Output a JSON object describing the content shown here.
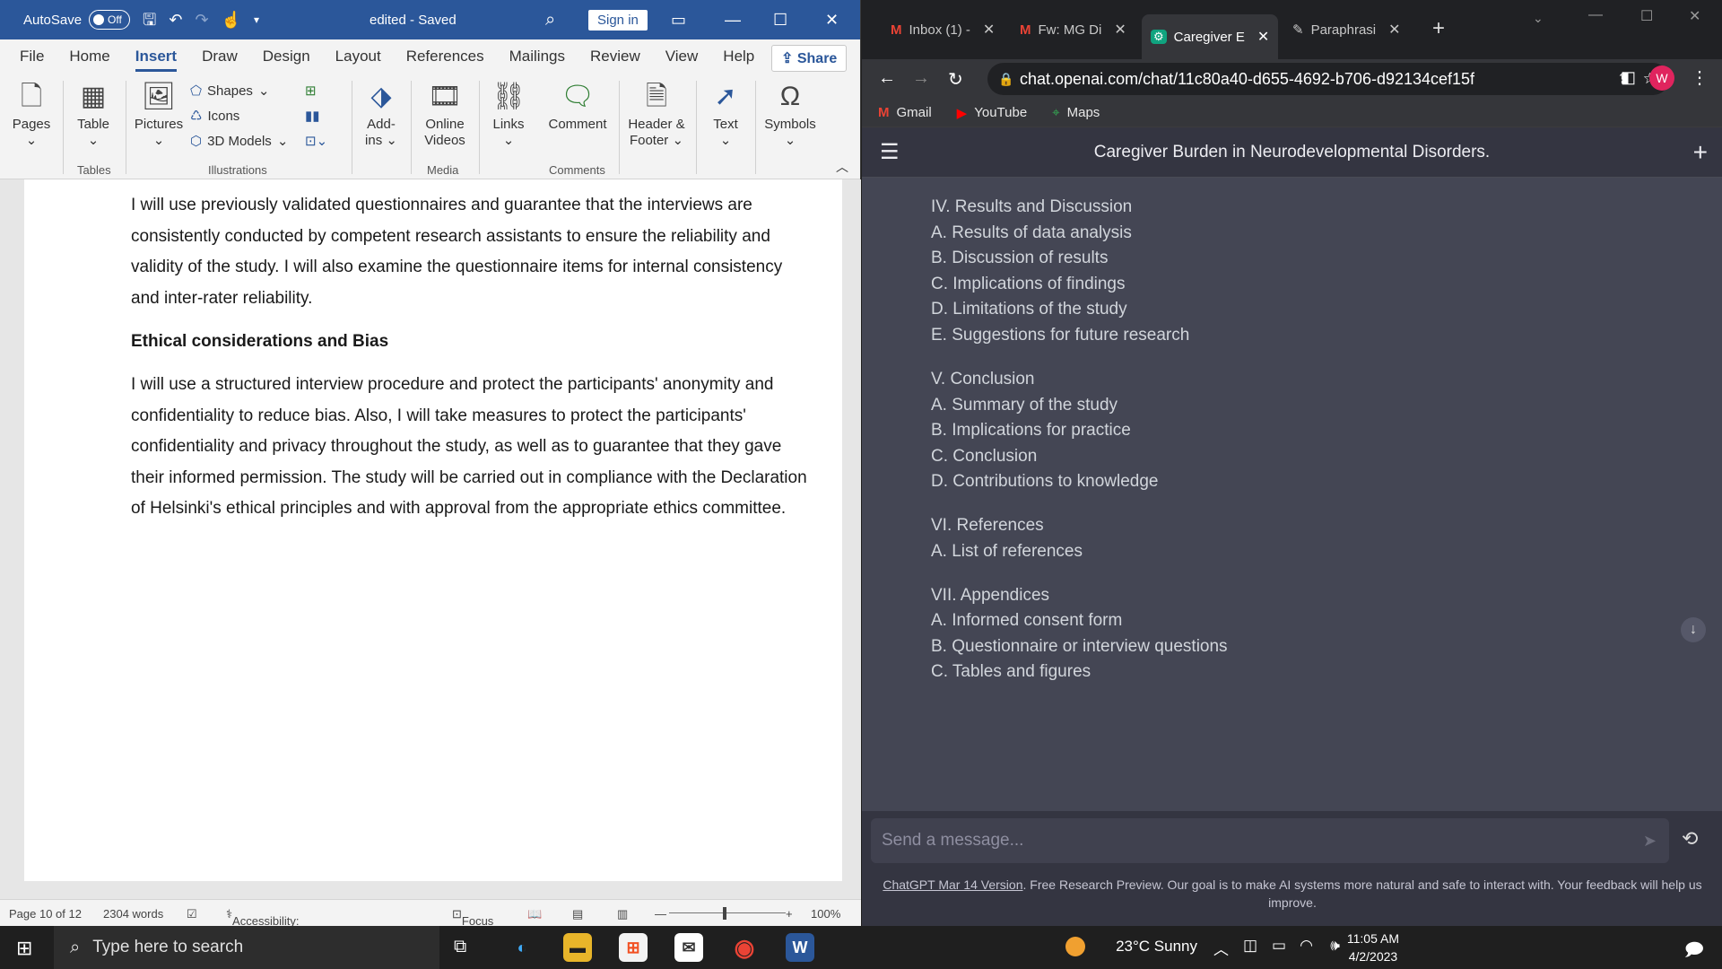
{
  "word": {
    "autosave_label": "AutoSave",
    "autosave_state": "Off",
    "doc_title": "edited  -  Saved",
    "sign_in": "Sign in",
    "tabs": [
      "File",
      "Home",
      "Insert",
      "Draw",
      "Design",
      "Layout",
      "References",
      "Mailings",
      "Review",
      "View",
      "Help"
    ],
    "share": "Share",
    "ribbon": {
      "pages": "Pages",
      "table": "Table",
      "pictures": "Pictures",
      "shapes": "Shapes",
      "icons": "Icons",
      "models": "3D Models",
      "addins_1": "Add-",
      "addins_2": "ins",
      "online_1": "Online",
      "online_2": "Videos",
      "links": "Links",
      "comment": "Comment",
      "header_1": "Header &",
      "header_2": "Footer",
      "text": "Text",
      "symbols": "Symbols",
      "groups": {
        "tables": "Tables",
        "illustrations": "Illustrations",
        "media": "Media",
        "comments": "Comments"
      }
    },
    "document": {
      "para1": "I will use previously validated questionnaires and guarantee that the interviews are consistently conducted by competent research assistants to ensure the reliability and validity of the study. I will also examine the questionnaire items for internal consistency and inter-rater reliability.",
      "heading": "Ethical considerations and Bias",
      "para2": "I will use a structured interview procedure and protect the participants' anonymity and confidentiality to reduce bias. Also, I will take measures to protect the participants' confidentiality and privacy throughout the study, as well as to guarantee that they gave their informed permission. The study will be carried out in compliance with the Declaration of Helsinki's ethical principles and with approval from the appropriate ethics committee."
    },
    "status": {
      "page": "Page 10 of 12",
      "words": "2304 words",
      "accessibility": "Accessibility: Good to go",
      "focus": "Focus",
      "zoom": "100%"
    }
  },
  "browser": {
    "tabs": [
      {
        "label": "Inbox (1) -",
        "icon": "gmail-icon"
      },
      {
        "label": "Fw: MG Di",
        "icon": "gmail-icon"
      },
      {
        "label": "Caregiver E",
        "icon": "chatgpt-icon"
      },
      {
        "label": "Paraphrasi",
        "icon": "quill-icon"
      }
    ],
    "url": "chat.openai.com/chat/11c80a40-d655-4692-b706-d92134cef15f",
    "avatar": "W",
    "bookmarks": [
      "Gmail",
      "YouTube",
      "Maps"
    ],
    "chat_title": "Caregiver Burden in Neurodevelopmental Disorders.",
    "outline": [
      "IV. Results and Discussion",
      "A. Results of data analysis",
      "B. Discussion of results",
      "C. Implications of findings",
      "D. Limitations of the study",
      "E. Suggestions for future research",
      "V. Conclusion",
      "A. Summary of the study",
      "B. Implications for practice",
      "C. Conclusion",
      "D. Contributions to knowledge",
      "VI. References",
      "A. List of references",
      "VII. Appendices",
      "A. Informed consent form",
      "B. Questionnaire or interview questions",
      "C. Tables and figures"
    ],
    "message_placeholder": "Send a message...",
    "footer_link": "ChatGPT Mar 14 Version",
    "footer_text": ". Free Research Preview. Our goal is to make AI systems more natural and safe to interact with. Your feedback will help us improve."
  },
  "taskbar": {
    "search_placeholder": "Type here to search",
    "weather": "23°C  Sunny",
    "time": "11:05 AM",
    "date": "4/2/2023"
  }
}
